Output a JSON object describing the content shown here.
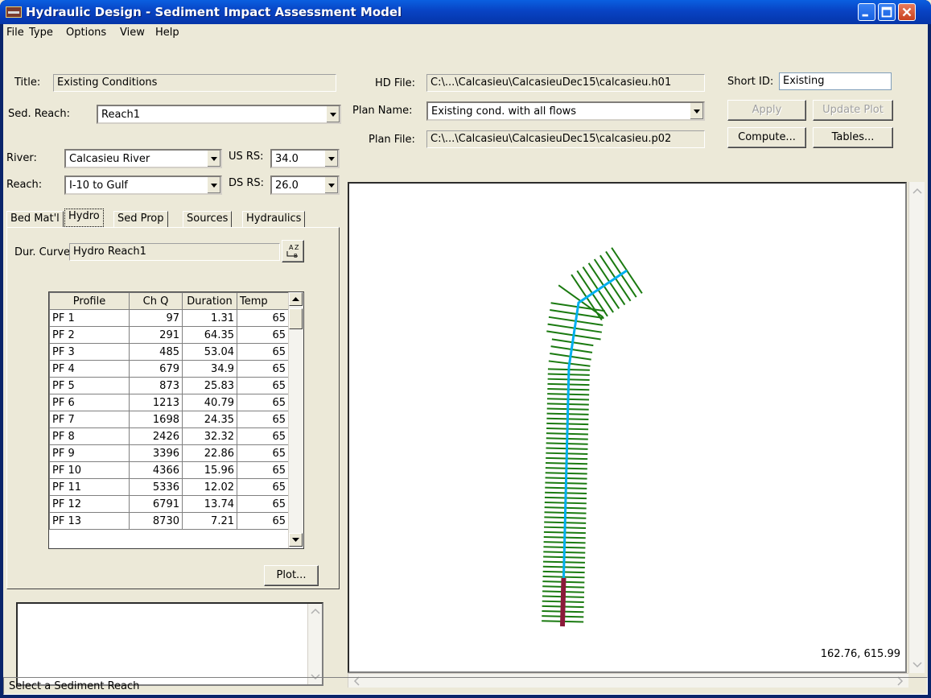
{
  "window": {
    "title": "Hydraulic Design - Sediment Impact Assessment Model"
  },
  "menu": [
    "File",
    "Type",
    "Options",
    "View",
    "Help"
  ],
  "left": {
    "title_label": "Title:",
    "title_value": "Existing Conditions",
    "sed_reach_label": "Sed. Reach:",
    "sed_reach_value": "Reach1",
    "river_label": "River:",
    "river_value": "Calcasieu River",
    "reach_label": "Reach:",
    "reach_value": "I-10 to Gulf",
    "us_rs_label": "US RS:",
    "us_rs_value": "34.0",
    "ds_rs_label": "DS RS:",
    "ds_rs_value": "26.0"
  },
  "tabs": [
    "Bed Mat'l",
    "Hydro",
    "Sed Prop",
    "Sources",
    "Hydraulics"
  ],
  "active_tab": "Hydro",
  "hydro": {
    "dur_curve_label": "Dur. Curve",
    "dur_curve_value": "Hydro Reach1",
    "columns": [
      "Profile",
      "Ch Q",
      "Duration",
      "Temp"
    ],
    "rows": [
      [
        "PF 1",
        "97",
        "1.31",
        "65"
      ],
      [
        "PF 2",
        "291",
        "64.35",
        "65"
      ],
      [
        "PF 3",
        "485",
        "53.04",
        "65"
      ],
      [
        "PF 4",
        "679",
        "34.9",
        "65"
      ],
      [
        "PF 5",
        "873",
        "25.83",
        "65"
      ],
      [
        "PF 6",
        "1213",
        "40.79",
        "65"
      ],
      [
        "PF 7",
        "1698",
        "24.35",
        "65"
      ],
      [
        "PF 8",
        "2426",
        "32.32",
        "65"
      ],
      [
        "PF 9",
        "3396",
        "22.86",
        "65"
      ],
      [
        "PF 10",
        "4366",
        "15.96",
        "65"
      ],
      [
        "PF 11",
        "5336",
        "12.02",
        "65"
      ],
      [
        "PF 12",
        "6791",
        "13.74",
        "65"
      ],
      [
        "PF 13",
        "8730",
        "7.21",
        "65"
      ]
    ],
    "plot_button": "Plot..."
  },
  "right": {
    "hd_file_label": "HD File:",
    "hd_file_value": "C:\\...\\Calcasieu\\CalcasieuDec15\\calcasieu.h01",
    "plan_name_label": "Plan Name:",
    "plan_name_value": "Existing cond. with all flows",
    "plan_file_label": "Plan File:",
    "plan_file_value": "C:\\...\\Calcasieu\\CalcasieuDec15\\calcasieu.p02",
    "short_id_label": "Short ID:",
    "short_id_value": "Existing",
    "apply": "Apply",
    "update_plot": "Update Plot",
    "compute": "Compute...",
    "tables": "Tables..."
  },
  "plot": {
    "coordinates": "162.76, 615.99"
  },
  "status": "Select a Sediment Reach",
  "colors": {
    "titlebar": "#0a5fe0",
    "xs_lines": "#1a7a10",
    "channel": "#00b0f0",
    "sed_reach": "#8b1a3a"
  }
}
